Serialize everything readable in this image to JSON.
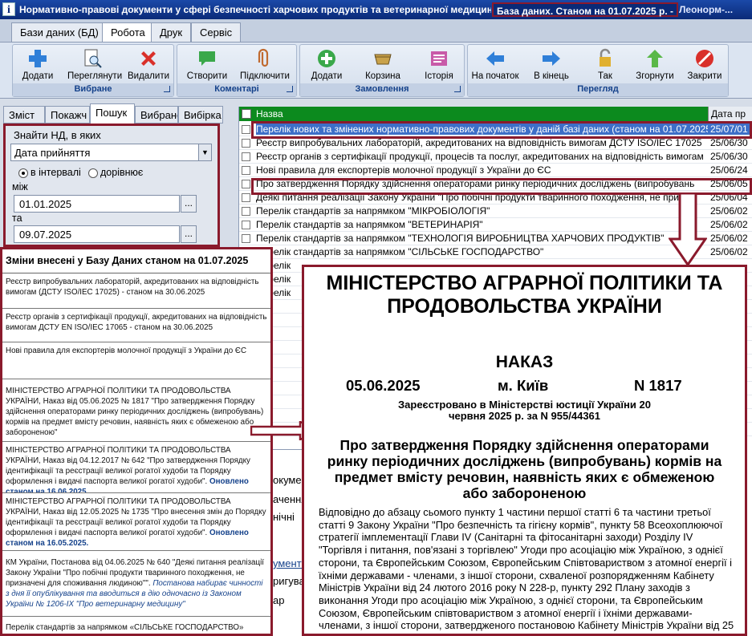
{
  "window": {
    "title": "Нормативно-правові документи у сфері безпечності харчових продуктів та ветеринарної медицини",
    "db_state": "База даних. Станом на 01.07.2025 р. -",
    "brand": "Леонорм-..."
  },
  "menu_tabs": [
    "Бази даних (БД)",
    "Робота",
    "Друк",
    "Сервіс"
  ],
  "ribbon": {
    "groups": [
      {
        "label": "Вибране",
        "buttons": [
          "Додати",
          "Переглянути",
          "Видалити"
        ]
      },
      {
        "label": "Коментарі",
        "buttons": [
          "Створити",
          "Підключити"
        ]
      },
      {
        "label": "Замовлення",
        "buttons": [
          "Додати",
          "Корзина",
          "Історія"
        ]
      },
      {
        "label": "Перегляд",
        "buttons": [
          "На початок",
          "В кінець",
          "Так",
          "Згорнути",
          "Закрити"
        ]
      }
    ]
  },
  "left_tabs": [
    "Зміст",
    "Покажч",
    "Пошук",
    "Вибране",
    "Вибірка"
  ],
  "search": {
    "find_label": "Знайти НД, в яких",
    "field": "Дата прийняття",
    "radio_interval": "в інтервалі",
    "radio_equal": "дорівнює",
    "from_label": "між",
    "from_value": "01.01.2025",
    "to_label": "та",
    "to_value": "09.07.2025",
    "dots": "..."
  },
  "grid": {
    "col_name": "Назва",
    "col_date": "Дата пр",
    "rows": [
      {
        "name": "Перелік нових та змінених нормативно-правових документів у даній базі даних (станом на 01.07.2025)",
        "date": "25/07/01"
      },
      {
        "name": "Реєстр випробувальних лабораторій, акредитованих на відповідність вимогам ДСТУ ISO/IEC 17025",
        "date": "25/06/30"
      },
      {
        "name": "Реєстр органів з сертифікації продукції, процесів та послуг, акредитованих на відповідність вимогам",
        "date": "25/06/30"
      },
      {
        "name": "Нові правила для експортерів молочної продукції з України до ЄС",
        "date": "25/06/24"
      },
      {
        "name": "Про затвердження Порядку здійснення операторами ринку періодичних досліджень (випробувань",
        "date": "25/06/05"
      },
      {
        "name": "Деякі питання реалізації Закону України \"Про побічні продукти тваринного походження, не призна",
        "date": "25/06/04"
      },
      {
        "name": "Перелік стандартів за напрямком \"МІКРОБІОЛОГІЯ\"",
        "date": "25/06/02"
      },
      {
        "name": "Перелік стандартів за напрямком \"ВЕТЕРИНАРІЯ\"",
        "date": "25/06/02"
      },
      {
        "name": "Перелік стандартів за напрямком \"ТЕХНОЛОГІЯ ВИРОБНИЦТВА ХАРЧОВИХ ПРОДУКТІВ\"",
        "date": "25/06/02"
      },
      {
        "name": "Перелік стандартів за напрямком \"СІЛЬСЬКЕ ГОСПОДАРСТВО\"",
        "date": "25/06/02"
      }
    ],
    "partial_left": [
      "Перелік",
      "Перелік",
      "Перелік"
    ],
    "bg_fragments": [
      "окумен",
      "ачення",
      "нічні",
      "ументи",
      "ригува",
      "ар"
    ]
  },
  "changes": {
    "title": "Зміни внесені у Базу Даних станом на 01.07.2025",
    "items": [
      {
        "text": "Реєстр випробувальних лабораторій, акредитованих на відповідність вимогам (ДСТУ ISO/IEC 17025) - станом на 30.06.2025"
      },
      {
        "text": "Реєстр органів з сертифікації продукції, акредитованих на відповідність вимогам ДСТУ EN ISO/IEC 17065 - станом на 30.06.2025"
      },
      {
        "text": "Нові правила для експортерів молочної продукції з України до ЄС"
      },
      {
        "text": "МІНІСТЕРСТВО АГРАРНОЇ ПОЛІТИКИ ТА ПРОДОВОЛЬСТВА УКРАЇНИ, Наказ від 05.06.2025 № 1817 \"Про затвердження Порядку здійснення операторами ринку періодичних досліджень (випробувань) кормів на предмет вмісту речовин, наявність яких є обмеженою або забороненою\""
      },
      {
        "text": "МІНІСТЕРСТВО АГРАРНОЇ ПОЛІТИКИ ТА ПРОДОВОЛЬСТВА УКРАЇНИ, Наказ від 04.12.2017 № 642 \"Про затвердження Порядку ідентифікації та реєстрації великої рогатої худоби та Порядку оформлення і видачі паспорта великої рогатої худоби\".",
        "updated": "Оновлено станом на 16.06.2025."
      },
      {
        "text": "МІНІСТЕРСТВО АГРАРНОЇ ПОЛІТИКИ ТА ПРОДОВОЛЬСТВА УКРАЇНИ, Наказ від 12.05.2025 № 1735 \"Про внесення змін до Порядку ідентифікації та реєстрації великої рогатої худоби та Порядку оформлення і видачі паспорта великої рогатої худоби\".",
        "updated": "Оновлено станом на 16.05.2025."
      },
      {
        "text": "КМ України, Постанова від 04.06.2025 № 640 \"Деякі питання реалізації Закону України \"Про побічні продукти тваринного походження, не призначені для споживання людиною\"\".",
        "note": "Постанова набирає чинності з дня її опублікування та вводиться в дію одночасно із Законом України № 1206-IX \"Про ветеринарну медицину\""
      },
      {
        "text": "Перелік стандартів за напрямком «СІЛЬСЬКЕ ГОСПОДАРСТВО» (станом на 02.06.2025)"
      }
    ]
  },
  "document": {
    "ministry": "МІНІСТЕРСТВО АГРАРНОЇ ПОЛІТИКИ ТА ПРОДОВОЛЬСТВА УКРАЇНИ",
    "kind": "НАКАЗ",
    "date": "05.06.2025",
    "city": "м. Київ",
    "number": "N 1817",
    "registered": "Зареєстровано в Міністерстві юстиції України 20 червня 2025 р. за N 955/44361",
    "title": "Про затвердження Порядку здійснення операторами ринку періодичних досліджень (випробувань) кормів на предмет вмісту речовин, наявність яких є обмеженою або забороненою",
    "body": "Відповідно до абзацу сьомого пункту 1 частини першої статті 6 та частини третьої статті 9 Закону України \"Про безпечність та гігієну кормів\", пункту 58 Всеохоплюючої стратегії імплементації Глави IV (Санітарні та фітосанітарні заходи) Розділу IV \"Торгівля і питання, пов'язані з торгівлею\" Угоди про асоціацію між Україною, з однієї сторони, та Європейським Союзом, Європейським Співтовариством з атомної енергії і їхніми державами - членами, з іншої сторони, схваленої розпорядженням Кабінету Міністрів України від 24 лютого 2016 року N 228-р, пункту 292 Плану заходів з виконання Угоди про асоціацію між Україною, з однієї сторони, та Європейським Союзом, Європейським співтовариством з атомної енергії і їхніми державами-членами, з іншої сторони, затвердженого постановою Кабінету Міністрів України від 25"
  },
  "colors": {
    "accent": "#8a1a2c",
    "header_green": "#0c8a1e",
    "title_blue": "#0a2a78",
    "selection": "#3d6fc8"
  }
}
